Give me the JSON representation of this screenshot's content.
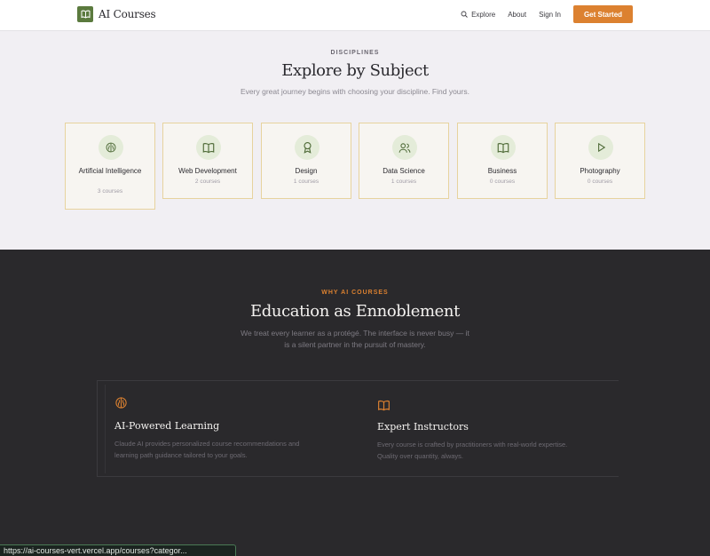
{
  "header": {
    "logo_text": "AI Courses",
    "nav": [
      {
        "label": "Explore",
        "icon": "search-icon"
      },
      {
        "label": "About"
      },
      {
        "label": "Sign In"
      }
    ],
    "cta_label": "Get Started"
  },
  "disciplines": {
    "eyebrow": "DISCIPLINES",
    "title": "Explore by Subject",
    "subtitle": "Every great journey begins with choosing your discipline. Find yours.",
    "cards": [
      {
        "title": "Artificial Intelligence",
        "count": "3 courses",
        "icon": "brain-icon"
      },
      {
        "title": "Web Development",
        "count": "2 courses",
        "icon": "book-icon"
      },
      {
        "title": "Design",
        "count": "1 courses",
        "icon": "award-icon"
      },
      {
        "title": "Data Science",
        "count": "1 courses",
        "icon": "users-icon"
      },
      {
        "title": "Business",
        "count": "0 courses",
        "icon": "book-icon"
      },
      {
        "title": "Photography",
        "count": "0 courses",
        "icon": "play-icon"
      }
    ]
  },
  "why": {
    "eyebrow": "WHY AI COURSES",
    "title": "Education as Ennoblement",
    "subtitle_line1": "We treat every learner as a protégé. The interface is never busy — it",
    "subtitle_line2": "is a silent partner in the pursuit of mastery.",
    "features": [
      {
        "title": "AI-Powered Learning",
        "line1": "Claude AI provides personalized course recommendations and",
        "line2": "learning path guidance tailored to your goals.",
        "icon": "brain-icon"
      },
      {
        "title": "Expert Instructors",
        "line1": "Every course is crafted by practitioners with real-world expertise.",
        "line2": "Quality over quantity, always.",
        "icon": "book-icon"
      }
    ]
  },
  "status_url": "https://ai-courses-vert.vercel.app/courses?categor...",
  "colors": {
    "accent": "#dc8130",
    "brand": "#5b7a3e",
    "card_border": "#e7d39e"
  }
}
